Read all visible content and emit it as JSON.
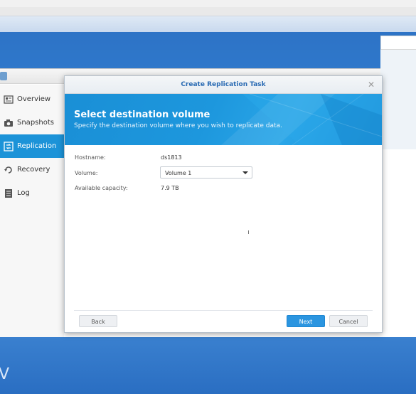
{
  "sidebar": {
    "items": [
      {
        "label": "Overview",
        "icon": "overview-icon"
      },
      {
        "label": "Snapshots",
        "icon": "camera-icon"
      },
      {
        "label": "Replication",
        "icon": "replication-icon"
      },
      {
        "label": "Recovery",
        "icon": "recovery-icon"
      },
      {
        "label": "Log",
        "icon": "log-icon"
      }
    ],
    "active_index": 2
  },
  "modal": {
    "title": "Create Replication Task",
    "close_icon": "close-icon",
    "banner": {
      "title": "Select destination volume",
      "subtitle": "Specify the destination volume where you wish to replicate data."
    },
    "fields": {
      "hostname_label": "Hostname:",
      "hostname_value": "ds1813",
      "volume_label": "Volume:",
      "volume_selected": "Volume 1",
      "capacity_label": "Available capacity:",
      "capacity_value": "7.9 TB"
    },
    "buttons": {
      "back": "Back",
      "next": "Next",
      "cancel": "Cancel"
    }
  },
  "colors": {
    "accent": "#1c93d8",
    "desktop": "#2a70c4",
    "primary_button": "#2b95e0"
  },
  "desktop": {
    "partial_label": "V"
  }
}
